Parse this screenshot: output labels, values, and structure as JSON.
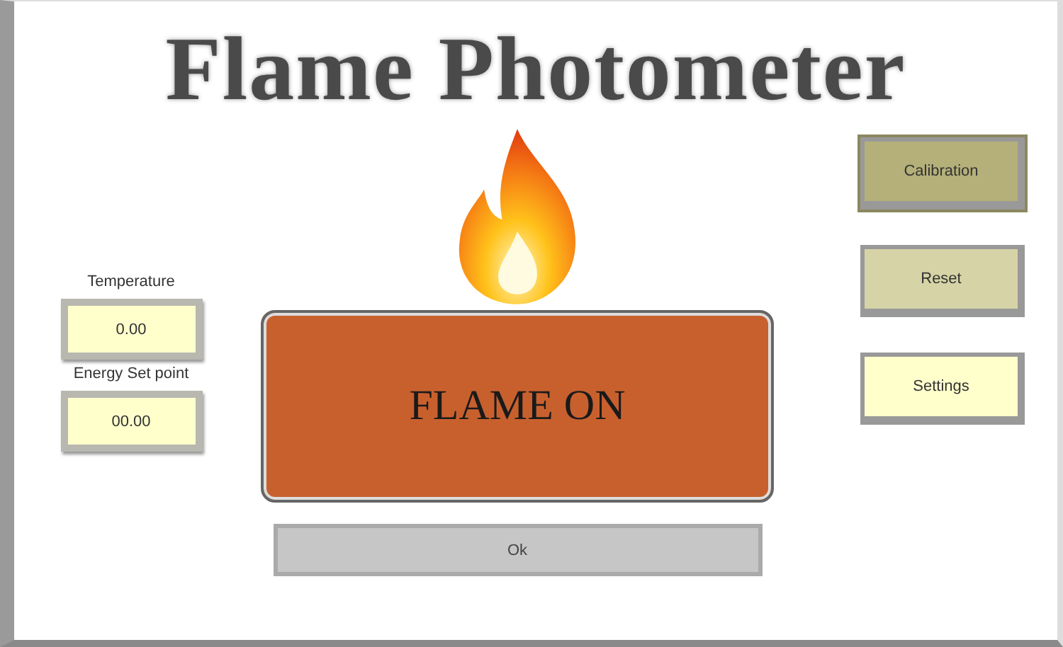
{
  "title": "Flame Photometer",
  "readouts": [
    {
      "label": "Temperature",
      "value": "0.00"
    },
    {
      "label": "Energy Set point",
      "value": "00.00"
    }
  ],
  "flame_button": {
    "label": "FLAME ON",
    "on": true
  },
  "status": "Ok",
  "buttons": [
    {
      "label": "Calibration",
      "selected": true
    },
    {
      "label": "Reset",
      "selected": false
    },
    {
      "label": "Settings",
      "selected": false
    }
  ]
}
